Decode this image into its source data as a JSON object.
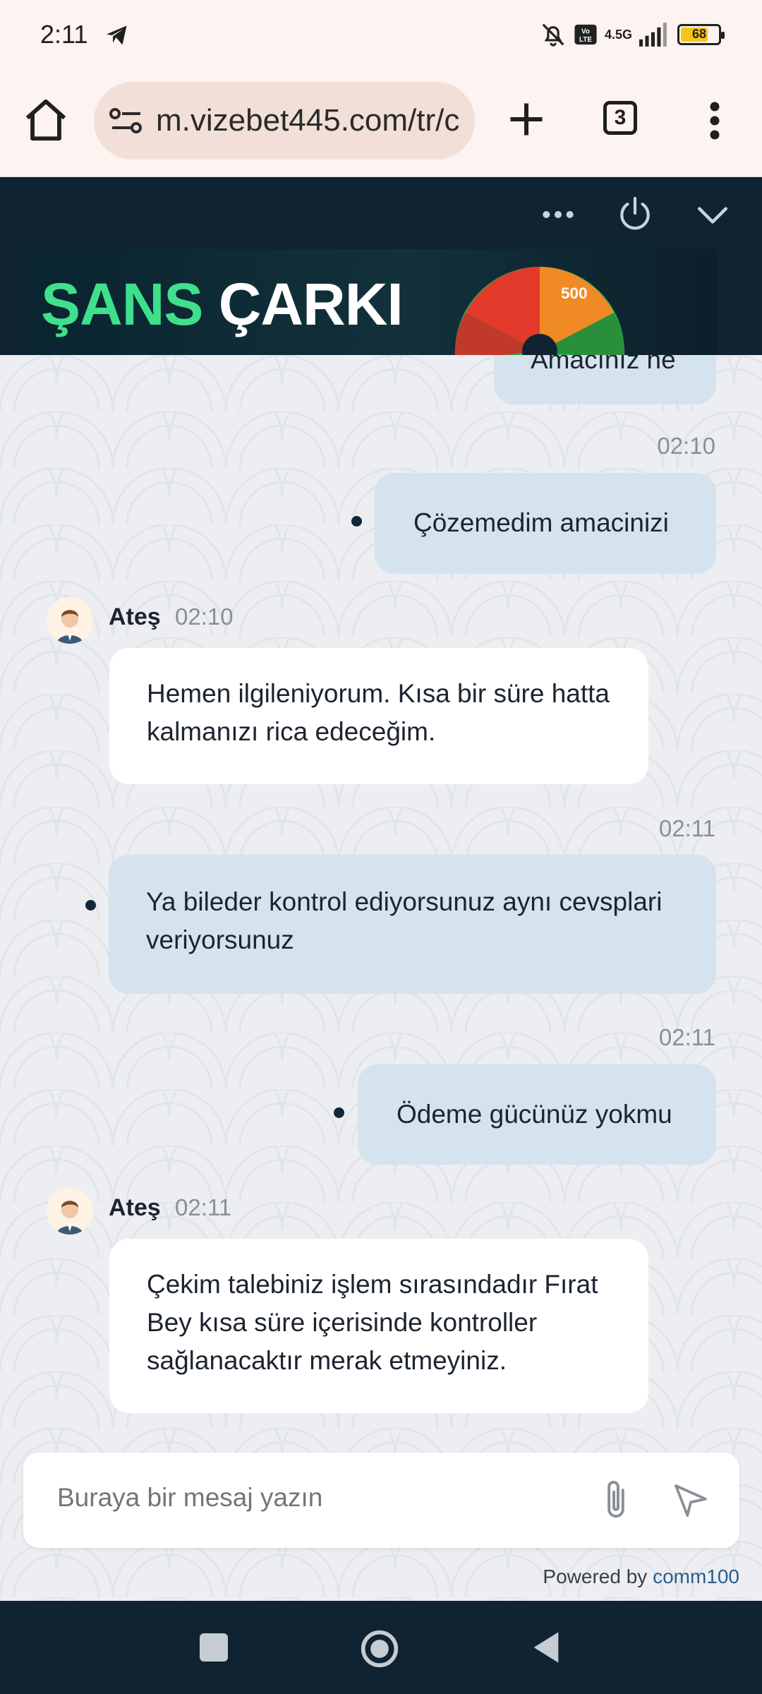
{
  "status": {
    "time": "2:11",
    "network": "4.5G",
    "battery": "68"
  },
  "browser": {
    "url": "m.vizebet445.com/tr/c",
    "tab_count": "3"
  },
  "chat_header": {
    "banner_word1": "ŞANS",
    "banner_word2": "ÇARKI",
    "wheel_label": "500"
  },
  "messages": [
    {
      "type": "out",
      "text": "Amacınız ne",
      "partial": true
    },
    {
      "type": "out",
      "time": "02:10",
      "text": "Çözemedim amacinizi"
    },
    {
      "type": "in",
      "agent": "Ateş",
      "time": "02:10",
      "text": "Hemen ilgileniyorum. Kısa bir süre hatta kalmanızı rica edeceğim."
    },
    {
      "type": "out",
      "time": "02:11",
      "text": "Ya bileder kontrol ediyorsunuz aynı cevsplari veriyorsunuz"
    },
    {
      "type": "out",
      "time": "02:11",
      "text": "Ödeme gücünüz yokmu"
    },
    {
      "type": "in",
      "agent": "Ateş",
      "time": "02:11",
      "text": "Çekim talebiniz işlem sırasındadır Fırat Bey kısa süre içerisinde kontroller sağlanacaktır merak etmeyiniz."
    }
  ],
  "composer": {
    "placeholder": "Buraya bir mesaj yazın"
  },
  "footer": {
    "powered_by": "Powered by",
    "brand": "comm100"
  },
  "colors": {
    "header_bg": "#0f2333",
    "outgoing_bubble": "#d5e3ee",
    "incoming_bubble": "#ffffff",
    "banner_green": "#3fe08c"
  }
}
